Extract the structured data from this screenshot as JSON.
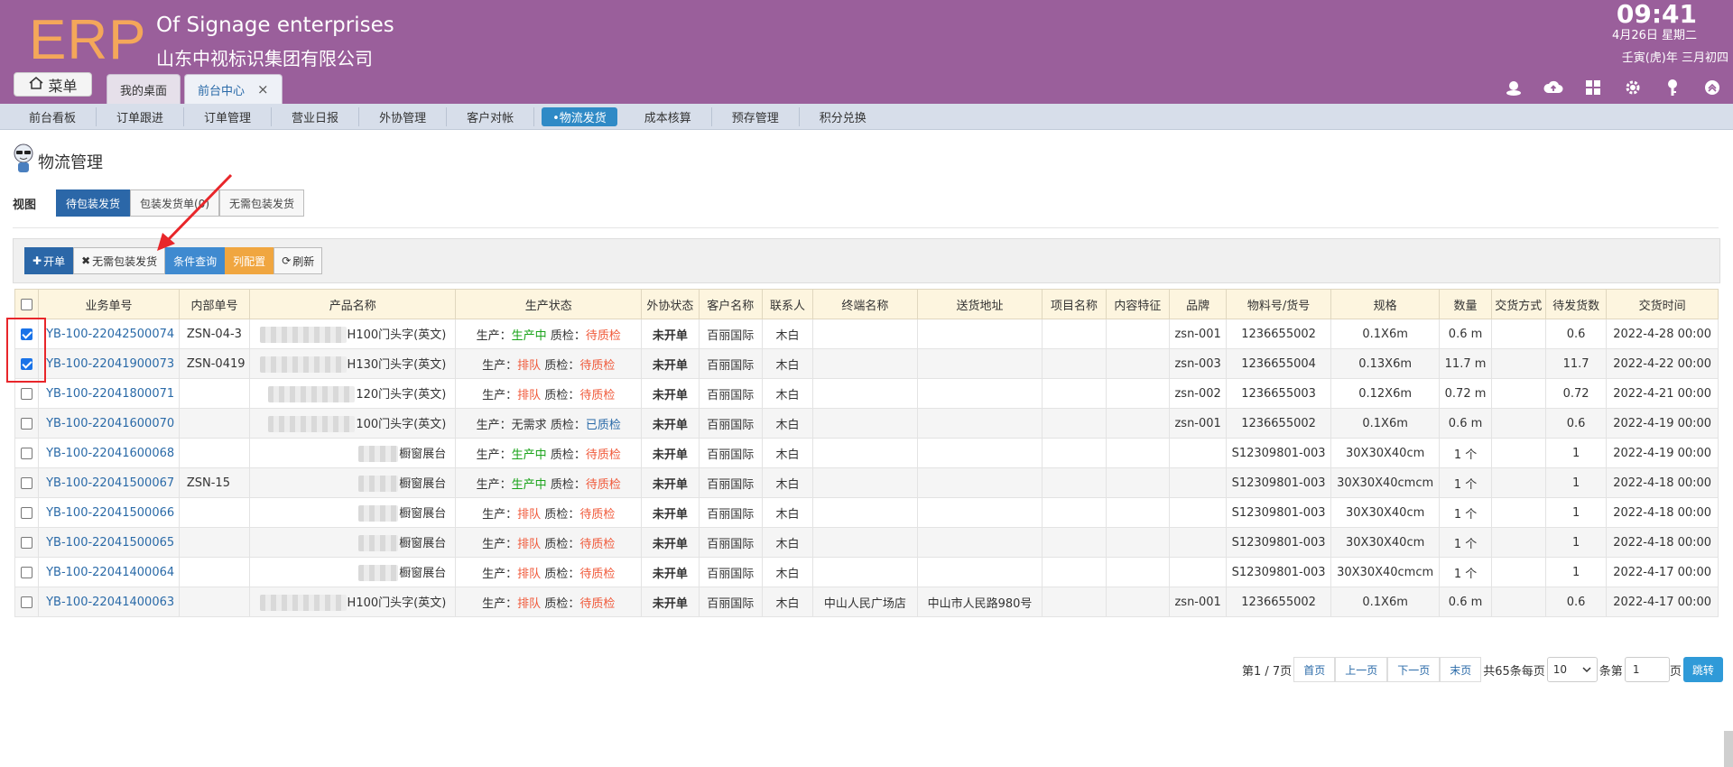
{
  "header": {
    "logo": "ERP",
    "company_en": "Of Signage enterprises",
    "company_cn": "山东中视标识集团有限公司",
    "time": "09:41",
    "date": "4月26日 星期二",
    "lunar": "壬寅(虎)年 三月初四",
    "menu_label": "菜单",
    "tabs": [
      {
        "label": "我的桌面",
        "active": false
      },
      {
        "label": "前台中心",
        "active": true,
        "close": "×"
      }
    ],
    "icons": [
      "user-icon",
      "cloud-upload-icon",
      "apps-grid-icon",
      "gear-icon",
      "key-icon",
      "collapse-up-icon"
    ]
  },
  "nav": {
    "items": [
      {
        "label": "前台看板"
      },
      {
        "label": "订单跟进"
      },
      {
        "label": "订单管理"
      },
      {
        "label": "营业日报"
      },
      {
        "label": "外协管理"
      },
      {
        "label": "客户对帐"
      },
      {
        "label": "•物流发货",
        "active": true
      },
      {
        "label": "成本核算"
      },
      {
        "label": "预存管理"
      },
      {
        "label": "积分兑换"
      }
    ]
  },
  "page": {
    "title": "物流管理",
    "view_label": "视图",
    "views": [
      {
        "label": "待包装发货",
        "active": true
      },
      {
        "label": "包装发货单(0)",
        "active": false
      },
      {
        "label": "无需包装发货",
        "active": false
      }
    ]
  },
  "toolbar": {
    "new_label": "开单",
    "no_pack_label": "无需包装发货",
    "query_label": "条件查询",
    "columns_label": "列配置",
    "refresh_label": "刷新"
  },
  "table": {
    "headers": [
      "业务单号",
      "内部单号",
      "产品名称",
      "生产状态",
      "外协状态",
      "客户名称",
      "联系人",
      "终端名称",
      "送货地址",
      "项目名称",
      "内容特征",
      "品牌",
      "物料号/货号",
      "规格",
      "数量",
      "交货方式",
      "待发货数",
      "交货时间"
    ],
    "status_labels": {
      "prod": "生产：",
      "qc": "质检："
    },
    "rows": [
      {
        "checked": true,
        "bno": "YB-100-22042500074",
        "ino": "ZSN-04-3",
        "pname": "H100门头字(英文)",
        "prod": "生产中",
        "prod_color": "green",
        "qc": "待质检",
        "qc_color": "orange",
        "wx": "未开单",
        "cust": "百丽国际",
        "contact": "木白",
        "term": "",
        "addr": "",
        "proj": "",
        "feat": "",
        "brand": "zsn-001",
        "mat": "1236655002",
        "spec": "0.1X6m",
        "qty": "0.6 m",
        "deliv": "",
        "pending": "0.6",
        "date": "2022-4-28 00:00"
      },
      {
        "checked": true,
        "bno": "YB-100-22041900073",
        "ino": "ZSN-0419",
        "pname": "H130门头字(英文)",
        "prod": "排队",
        "prod_color": "orange",
        "qc": "待质检",
        "qc_color": "orange",
        "wx": "未开单",
        "cust": "百丽国际",
        "contact": "木白",
        "term": "",
        "addr": "",
        "proj": "",
        "feat": "",
        "brand": "zsn-003",
        "mat": "1236655004",
        "spec": "0.13X6m",
        "qty": "11.7 m",
        "deliv": "",
        "pending": "11.7",
        "date": "2022-4-22 00:00"
      },
      {
        "checked": false,
        "bno": "YB-100-22041800071",
        "ino": "",
        "pname": "120门头字(英文)",
        "prod": "排队",
        "prod_color": "orange",
        "qc": "待质检",
        "qc_color": "orange",
        "wx": "未开单",
        "cust": "百丽国际",
        "contact": "木白",
        "term": "",
        "addr": "",
        "proj": "",
        "feat": "",
        "brand": "zsn-002",
        "mat": "1236655003",
        "spec": "0.12X6m",
        "qty": "0.72 m",
        "deliv": "",
        "pending": "0.72",
        "date": "2022-4-21 00:00"
      },
      {
        "checked": false,
        "bno": "YB-100-22041600070",
        "ino": "",
        "pname": "100门头字(英文)",
        "prod": "无需求",
        "prod_color": "plain",
        "qc": "已质检",
        "qc_color": "blue",
        "wx": "未开单",
        "cust": "百丽国际",
        "contact": "木白",
        "term": "",
        "addr": "",
        "proj": "",
        "feat": "",
        "brand": "zsn-001",
        "mat": "1236655002",
        "spec": "0.1X6m",
        "qty": "0.6 m",
        "deliv": "",
        "pending": "0.6",
        "date": "2022-4-19 00:00"
      },
      {
        "checked": false,
        "bno": "YB-100-22041600068",
        "ino": "",
        "pname": "橱窗展台",
        "short": true,
        "prod": "生产中",
        "prod_color": "green",
        "qc": "待质检",
        "qc_color": "orange",
        "wx": "未开单",
        "cust": "百丽国际",
        "contact": "木白",
        "term": "",
        "addr": "",
        "proj": "",
        "feat": "",
        "brand": "",
        "mat": "S12309801-003",
        "spec": "30X30X40cm",
        "qty": "1 个",
        "deliv": "",
        "pending": "1",
        "date": "2022-4-19 00:00"
      },
      {
        "checked": false,
        "bno": "YB-100-22041500067",
        "ino": "ZSN-15",
        "pname": "橱窗展台",
        "short": true,
        "prod": "生产中",
        "prod_color": "green",
        "qc": "待质检",
        "qc_color": "orange",
        "wx": "未开单",
        "cust": "百丽国际",
        "contact": "木白",
        "term": "",
        "addr": "",
        "proj": "",
        "feat": "",
        "brand": "",
        "mat": "S12309801-003",
        "spec": "30X30X40cmcm",
        "qty": "1 个",
        "deliv": "",
        "pending": "1",
        "date": "2022-4-18 00:00"
      },
      {
        "checked": false,
        "bno": "YB-100-22041500066",
        "ino": "",
        "pname": "橱窗展台",
        "short": true,
        "prod": "排队",
        "prod_color": "orange",
        "qc": "待质检",
        "qc_color": "orange",
        "wx": "未开单",
        "cust": "百丽国际",
        "contact": "木白",
        "term": "",
        "addr": "",
        "proj": "",
        "feat": "",
        "brand": "",
        "mat": "S12309801-003",
        "spec": "30X30X40cm",
        "qty": "1 个",
        "deliv": "",
        "pending": "1",
        "date": "2022-4-18 00:00"
      },
      {
        "checked": false,
        "bno": "YB-100-22041500065",
        "ino": "",
        "pname": "橱窗展台",
        "short": true,
        "prod": "排队",
        "prod_color": "orange",
        "qc": "待质检",
        "qc_color": "orange",
        "wx": "未开单",
        "cust": "百丽国际",
        "contact": "木白",
        "term": "",
        "addr": "",
        "proj": "",
        "feat": "",
        "brand": "",
        "mat": "S12309801-003",
        "spec": "30X30X40cm",
        "qty": "1 个",
        "deliv": "",
        "pending": "1",
        "date": "2022-4-18 00:00"
      },
      {
        "checked": false,
        "bno": "YB-100-22041400064",
        "ino": "",
        "pname": "橱窗展台",
        "short": true,
        "prod": "排队",
        "prod_color": "orange",
        "qc": "待质检",
        "qc_color": "orange",
        "wx": "未开单",
        "cust": "百丽国际",
        "contact": "木白",
        "term": "",
        "addr": "",
        "proj": "",
        "feat": "",
        "brand": "",
        "mat": "S12309801-003",
        "spec": "30X30X40cmcm",
        "qty": "1 个",
        "deliv": "",
        "pending": "1",
        "date": "2022-4-17 00:00"
      },
      {
        "checked": false,
        "bno": "YB-100-22041400063",
        "ino": "",
        "pname": "H100门头字(英文)",
        "prod": "排队",
        "prod_color": "orange",
        "qc": "待质检",
        "qc_color": "orange",
        "wx": "未开单",
        "cust": "百丽国际",
        "contact": "木白",
        "term": "中山人民广场店",
        "addr": "中山市人民路980号",
        "proj": "",
        "feat": "",
        "brand": "zsn-001",
        "mat": "1236655002",
        "spec": "0.1X6m",
        "qty": "0.6 m",
        "deliv": "",
        "pending": "0.6",
        "date": "2022-4-17 00:00"
      }
    ]
  },
  "pager": {
    "page_info": "第1 / 7页",
    "first": "首页",
    "prev": "上一页",
    "next": "下一页",
    "last": "末页",
    "total_text": "共65条每页",
    "per_page": "10",
    "per_page_suffix": "条第",
    "page_input": "1",
    "page_suffix": "页",
    "go": "跳转"
  },
  "colors": {
    "header_bg": "#9a5f9b",
    "logo": "#f4a75a",
    "nav_active": "#2f8ac6",
    "link": "#2a6aa8",
    "status_green": "#1aa31a",
    "status_orange": "#f0593a",
    "status_red": "#e02020",
    "highlight_box": "#e8262a"
  }
}
